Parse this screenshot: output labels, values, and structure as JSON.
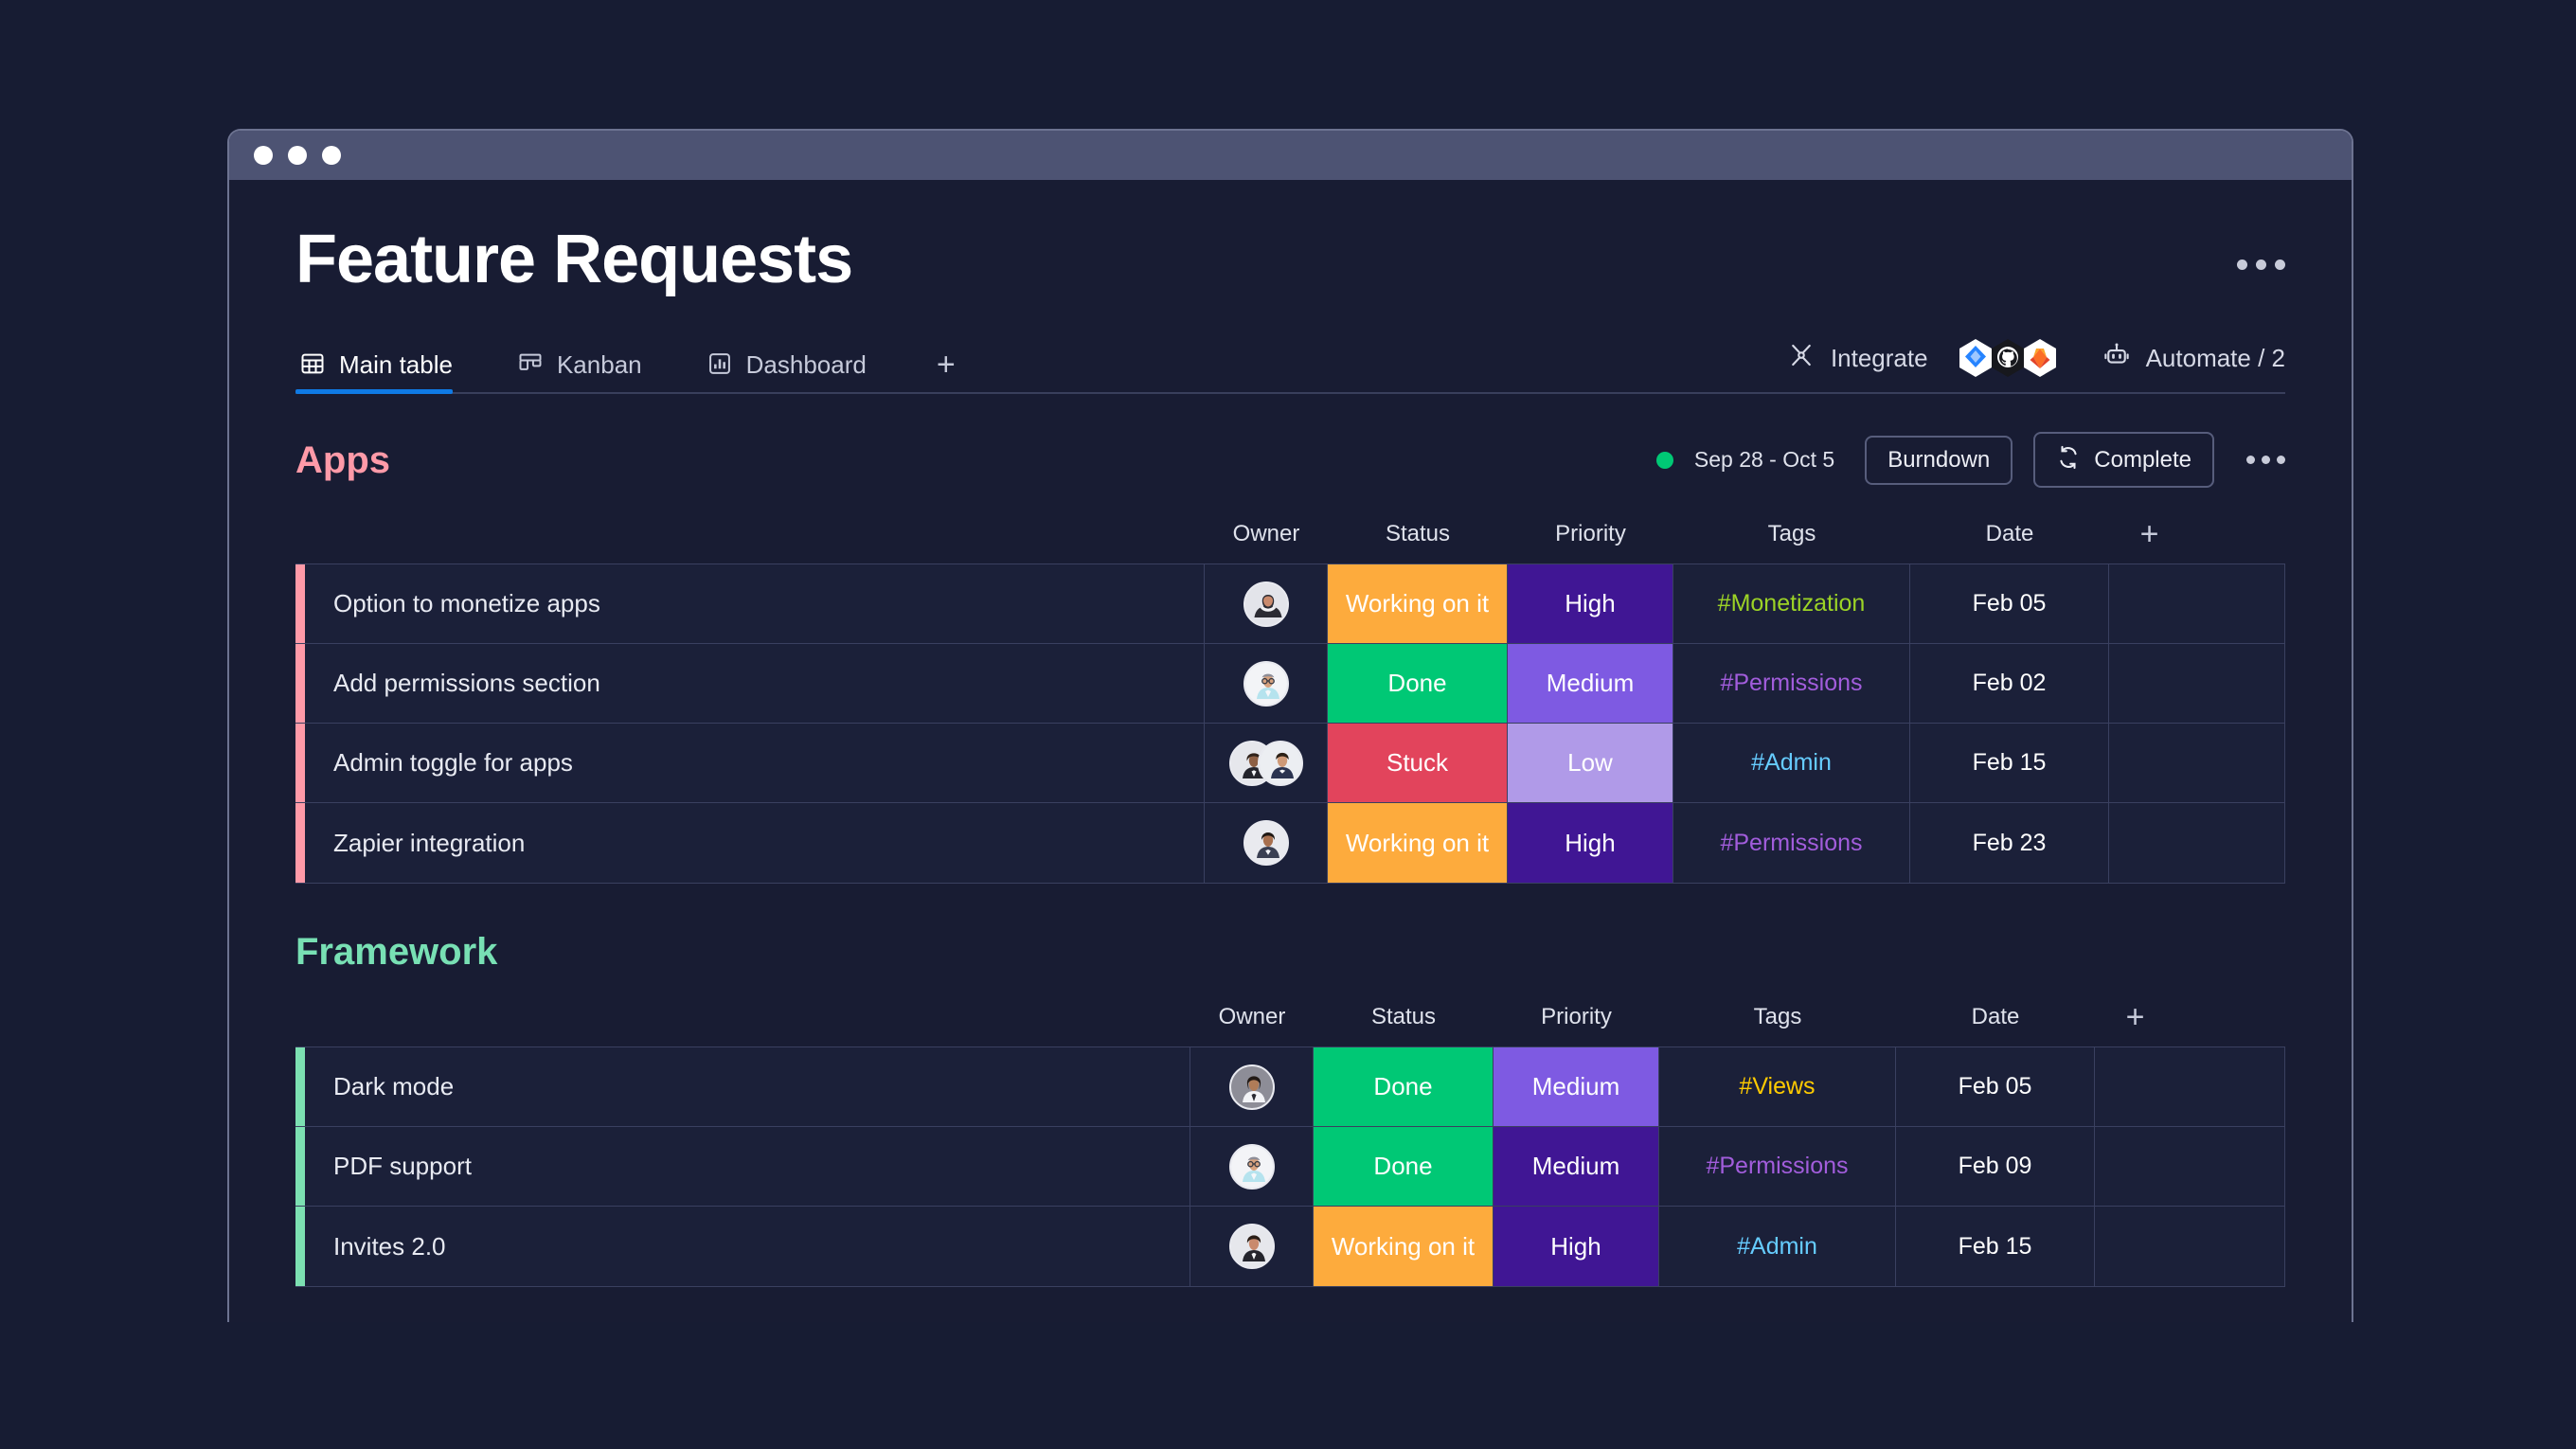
{
  "window": {
    "dots": [
      "close",
      "minimize",
      "maximize"
    ]
  },
  "header": {
    "title": "Feature Requests",
    "overflow_icon": "kebab-horizontal-icon"
  },
  "tabs": {
    "items": [
      {
        "label": "Main table",
        "icon": "table-grid-icon",
        "active": true
      },
      {
        "label": "Kanban",
        "icon": "kanban-board-icon",
        "active": false
      },
      {
        "label": "Dashboard",
        "icon": "bar-chart-icon",
        "active": false
      }
    ],
    "add_label": "+",
    "active_underline_color": "#0f7ae5"
  },
  "toolbar_right": {
    "integrate_label": "Integrate",
    "integrate_icon": "integrate-nodes-icon",
    "integration_apps": [
      "jira",
      "github",
      "gitlab"
    ],
    "automate_label": "Automate / 2",
    "automate_icon": "robot-icon"
  },
  "columns": [
    "Owner",
    "Status",
    "Priority",
    "Tags",
    "Date"
  ],
  "add_column_label": "+",
  "groups": [
    {
      "title": "Apps",
      "title_color": "#ff9aa8",
      "accent_color": "#ff9aa8",
      "sprint": {
        "dot_color": "#00c875",
        "range": "Sep 28 - Oct 5",
        "burndown_label": "Burndown",
        "complete_label": "Complete",
        "complete_icon": "refresh-cycle-icon",
        "overflow_icon": "kebab-horizontal-icon"
      },
      "rows": [
        {
          "name": "Option to monetize apps",
          "owners": 1,
          "status": "Working on it",
          "status_color": "#fdab3d",
          "priority": "High",
          "priority_color": "#401694",
          "tag": "#Monetization",
          "tag_color": "#9cd326",
          "date": "Feb 05"
        },
        {
          "name": "Add permissions section",
          "owners": 1,
          "status": "Done",
          "status_color": "#00c875",
          "priority": "Medium",
          "priority_color": "#7e5ae2",
          "tag": "#Permissions",
          "tag_color": "#a25ddc",
          "date": "Feb 02"
        },
        {
          "name": "Admin toggle for apps",
          "owners": 2,
          "status": "Stuck",
          "status_color": "#e2445c",
          "priority": "Low",
          "priority_color": "#b09ae8",
          "tag": "#Admin",
          "tag_color": "#66ccff",
          "date": "Feb 15"
        },
        {
          "name": "Zapier integration",
          "owners": 1,
          "status": "Working on it",
          "status_color": "#fdab3d",
          "priority": "High",
          "priority_color": "#401694",
          "tag": "#Permissions",
          "tag_color": "#a25ddc",
          "date": "Feb 23"
        }
      ]
    },
    {
      "title": "Framework",
      "title_color": "#78e0b4",
      "accent_color": "#7ce0b2",
      "rows": [
        {
          "name": "Dark mode",
          "owners": 1,
          "status": "Done",
          "status_color": "#00c875",
          "priority": "Medium",
          "priority_color": "#7e5ae2",
          "tag": "#Views",
          "tag_color": "#ffcb00",
          "date": "Feb 05"
        },
        {
          "name": "PDF support",
          "owners": 1,
          "status": "Done",
          "status_color": "#00c875",
          "priority": "Medium",
          "priority_color": "#401694",
          "tag": "#Permissions",
          "tag_color": "#a25ddc",
          "date": "Feb 09"
        },
        {
          "name": "Invites 2.0",
          "owners": 1,
          "status": "Working on it",
          "status_color": "#fdab3d",
          "priority": "High",
          "priority_color": "#401694",
          "tag": "#Admin",
          "tag_color": "#66ccff",
          "date": "Feb 15"
        }
      ]
    }
  ]
}
